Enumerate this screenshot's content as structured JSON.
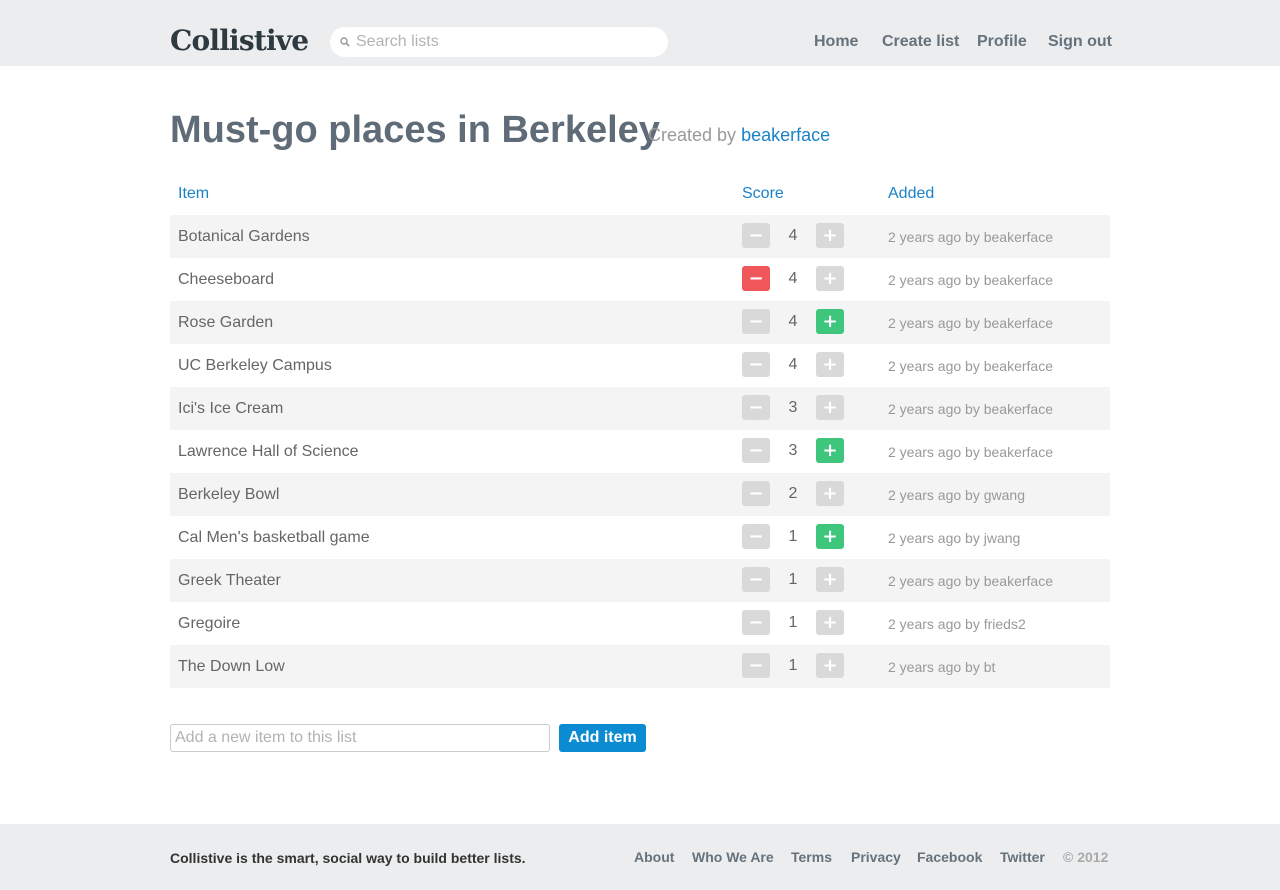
{
  "header": {
    "logo": "Collistive",
    "search_placeholder": "Search lists",
    "nav": [
      "Home",
      "Create list",
      "Profile",
      "Sign out"
    ]
  },
  "list": {
    "title": "Must-go places in Berkeley",
    "created_by_prefix": "Created by",
    "creator": "beakerface"
  },
  "table": {
    "headers": {
      "item": "Item",
      "score": "Score",
      "added": "Added"
    },
    "vote_minus_glyph": "−",
    "vote_plus_glyph": "+",
    "rows": [
      {
        "item": "Botanical Gardens",
        "score": "4",
        "added": "2 years ago by beakerface",
        "vote": "none"
      },
      {
        "item": "Cheeseboard",
        "score": "4",
        "added": "2 years ago by beakerface",
        "vote": "down"
      },
      {
        "item": "Rose Garden",
        "score": "4",
        "added": "2 years ago by beakerface",
        "vote": "up"
      },
      {
        "item": "UC Berkeley Campus",
        "score": "4",
        "added": "2 years ago by beakerface",
        "vote": "none"
      },
      {
        "item": "Ici's Ice Cream",
        "score": "3",
        "added": "2 years ago by beakerface",
        "vote": "none"
      },
      {
        "item": "Lawrence Hall of Science",
        "score": "3",
        "added": "2 years ago by beakerface",
        "vote": "up"
      },
      {
        "item": "Berkeley Bowl",
        "score": "2",
        "added": "2 years ago by gwang",
        "vote": "none"
      },
      {
        "item": "Cal Men's basketball game",
        "score": "1",
        "added": "2 years ago by jwang",
        "vote": "up"
      },
      {
        "item": "Greek Theater",
        "score": "1",
        "added": "2 years ago by beakerface",
        "vote": "none"
      },
      {
        "item": "Gregoire",
        "score": "1",
        "added": "2 years ago by frieds2",
        "vote": "none"
      },
      {
        "item": "The Down Low",
        "score": "1",
        "added": "2 years ago by bt",
        "vote": "none"
      }
    ]
  },
  "add_form": {
    "placeholder": "Add a new item to this list",
    "button": "Add item"
  },
  "footer": {
    "tagline": "Collistive is the smart, social way to build better lists.",
    "links": [
      "About",
      "Who We Are",
      "Terms",
      "Privacy",
      "Facebook",
      "Twitter"
    ],
    "copyright": "© 2012"
  },
  "colors": {
    "accent": "#1a82c7",
    "button": "#0b8bd1",
    "downvote_active": "#f0575a",
    "upvote_active": "#3ec77c",
    "vote_inactive": "#d9d9d9",
    "bar": "#ebedee"
  }
}
